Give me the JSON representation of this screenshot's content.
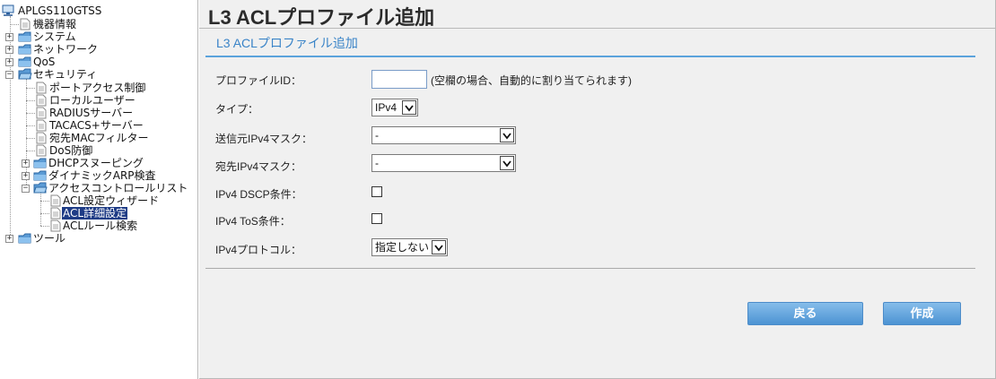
{
  "tree": {
    "root": "APLGS110GTSS",
    "items": [
      "機器情報",
      "システム",
      "ネットワーク",
      "QoS",
      "セキュリティ",
      "ポートアクセス制御",
      "ローカルユーザー",
      "RADIUSサーバー",
      "TACACS+サーバー",
      "宛先MACフィルター",
      "DoS防御",
      "DHCPスヌーピング",
      "ダイナミックARP検査",
      "アクセスコントロールリスト",
      "ACL設定ウィザード",
      "ACL詳細設定",
      "ACLルール検索",
      "ツール"
    ]
  },
  "page": {
    "title": "L3 ACLプロファイル追加",
    "section_title": "L3 ACLプロファイル追加"
  },
  "form": {
    "profile_id_label": "プロファイルID：",
    "profile_id_value": "",
    "profile_id_hint": "(空欄の場合、自動的に割り当てられます)",
    "type_label": "タイプ：",
    "type_value": "IPv4",
    "src_mask_label": "送信元IPv4マスク：",
    "src_mask_value": "-",
    "dst_mask_label": "宛先IPv4マスク：",
    "dst_mask_value": "-",
    "dscp_label": "IPv4 DSCP条件：",
    "tos_label": "IPv4 ToS条件：",
    "protocol_label": "IPv4プロトコル：",
    "protocol_value": "指定しない"
  },
  "buttons": {
    "back": "戻る",
    "create": "作成"
  },
  "colors": {
    "accent": "#3a84c8",
    "button": "#4c93d3",
    "selected": "#1f3c86"
  }
}
